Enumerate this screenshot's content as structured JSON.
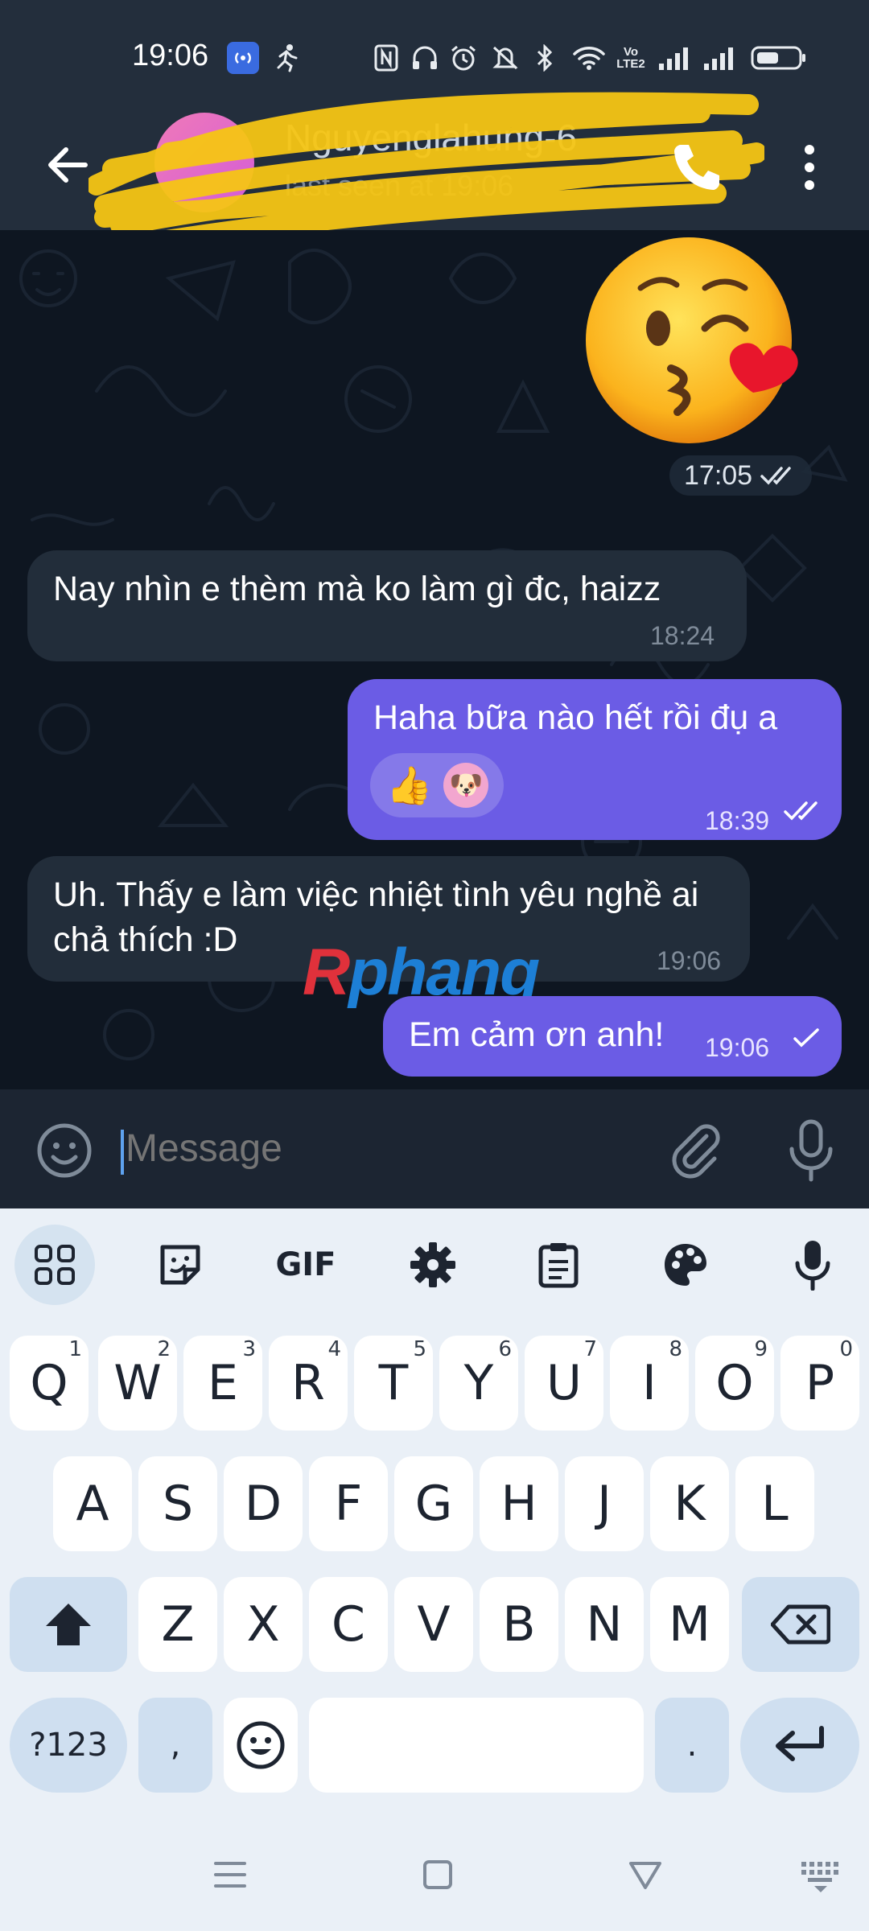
{
  "status_bar": {
    "time": "19:06",
    "icons": [
      "hotspot-icon",
      "running-icon",
      "nfc-icon",
      "headphones-icon",
      "alarm-icon",
      "mute-icon",
      "bluetooth-icon",
      "wifi-icon",
      "volte-icon",
      "signal-icon",
      "signal-icon",
      "battery-icon"
    ],
    "volte_label": "Vo\nLTE2"
  },
  "header": {
    "contact_name": "Nguyenglahung-6",
    "status": "last seen at 19:06"
  },
  "chat": {
    "sticker": {
      "emoji": "😘",
      "time": "17:05"
    },
    "messages": [
      {
        "direction": "in",
        "text": "Nay nhìn e thèm mà ko làm gì đc, haizz",
        "time": "18:24"
      },
      {
        "direction": "out",
        "text": "Haha bữa nào hết rồi đụ a",
        "time": "18:39",
        "reactions": [
          "👍",
          "🐶"
        ]
      },
      {
        "direction": "in",
        "text": "Uh. Thấy e làm việc nhiệt tình yêu nghề ai chả thích :D",
        "time": "19:06"
      },
      {
        "direction": "out",
        "text": "Em cảm ơn anh!",
        "time": "19:06"
      }
    ],
    "watermark": {
      "first": "R",
      "rest": "phang"
    }
  },
  "input": {
    "placeholder": "Message"
  },
  "keyboard": {
    "toolbar": [
      "apps-icon",
      "sticker-icon",
      "GIF",
      "settings-icon",
      "clipboard-icon",
      "palette-icon",
      "mic-icon"
    ],
    "row1": [
      {
        "k": "Q",
        "n": "1"
      },
      {
        "k": "W",
        "n": "2"
      },
      {
        "k": "E",
        "n": "3"
      },
      {
        "k": "R",
        "n": "4"
      },
      {
        "k": "T",
        "n": "5"
      },
      {
        "k": "Y",
        "n": "6"
      },
      {
        "k": "U",
        "n": "7"
      },
      {
        "k": "I",
        "n": "8"
      },
      {
        "k": "O",
        "n": "9"
      },
      {
        "k": "P",
        "n": "0"
      }
    ],
    "row2": [
      "A",
      "S",
      "D",
      "F",
      "G",
      "H",
      "J",
      "K",
      "L"
    ],
    "row3": [
      "Z",
      "X",
      "C",
      "V",
      "B",
      "N",
      "M"
    ],
    "row4": {
      "symbols": "?123",
      "comma": ",",
      "period": "."
    }
  },
  "colors": {
    "chat_bg": "#0e1621",
    "bubble_in": "#222d3a",
    "bubble_out": "#6b5ce5",
    "header_bg": "#232e3c",
    "keyboard_bg": "#eaf0f7"
  }
}
